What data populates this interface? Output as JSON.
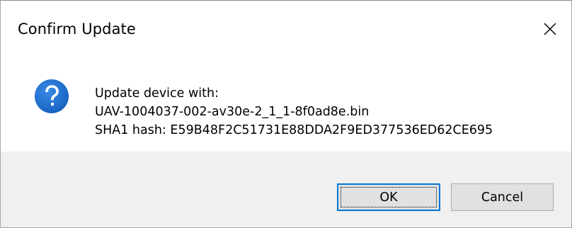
{
  "dialog": {
    "title": "Confirm Update",
    "close_icon": "close-icon",
    "message": {
      "icon": "question-icon",
      "line1": "Update device with:",
      "line2": "UAV-1004037-002-av30e-2_1_1-8f0ad8e.bin",
      "line3": "SHA1 hash: E59B48F2C51731E88DDA2F9ED377536ED62CE695"
    },
    "buttons": {
      "ok_label": "OK",
      "cancel_label": "Cancel"
    }
  },
  "colors": {
    "footer_bg": "#f0f0f0",
    "icon_blue": "#1e6fd0",
    "focus_border": "#0078d7"
  }
}
